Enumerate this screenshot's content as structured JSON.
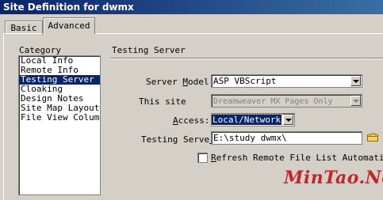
{
  "window": {
    "title": "Site Definition for dwmx"
  },
  "tabs": [
    {
      "label": "Basic",
      "active": false
    },
    {
      "label": "Advanced",
      "active": true
    }
  ],
  "category": {
    "label": "Category",
    "items": [
      "Local Info",
      "Remote Info",
      "Testing Server",
      "Cloaking",
      "Design Notes",
      "Site Map Layout",
      "File View Columns"
    ],
    "selected": "Testing Server"
  },
  "section": {
    "title": "Testing Server"
  },
  "form": {
    "server_model": {
      "label_pre": "Server ",
      "label_key": "M",
      "label_post": "odel:",
      "value": "ASP VBScript"
    },
    "this_site": {
      "label": "This site",
      "value": "Dreamweaver MX Pages Only"
    },
    "access": {
      "label_key": "A",
      "label_post": "ccess:",
      "value": "Local/Network"
    },
    "testing_server": {
      "label_pre": "Testing Serve",
      "label_key": "r",
      "value": "E:\\study dwmx\\"
    },
    "refresh": {
      "label_key": "R",
      "label_post": "efresh Remote File List Automatic",
      "checked": false
    }
  },
  "watermark": "MinTao.Net",
  "colors": {
    "titlebar": "#0a246a",
    "selection": "#0a246a",
    "watermark": "#c4252c",
    "face": "#d4d0c8"
  }
}
